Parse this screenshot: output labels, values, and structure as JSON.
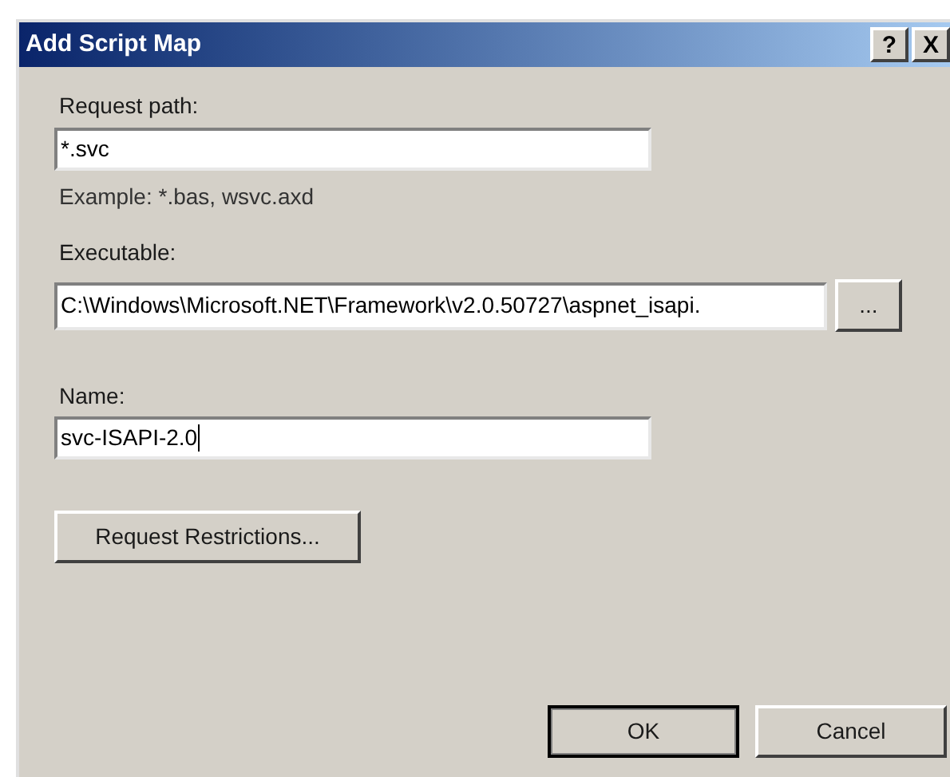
{
  "window": {
    "title": "Add Script Map",
    "title_buttons": [
      "?",
      "X"
    ]
  },
  "fields": [
    {
      "label": "Request path:",
      "value": "*.svc",
      "hint": "Example: *.bas, wsvc.axd",
      "focused": false
    },
    {
      "label": "Executable:",
      "value": "C:\\Windows\\Microsoft.NET\\Framework\\v2.0.50727\\aspnet_isapi.",
      "browse": "...",
      "focused": false
    },
    {
      "label": "Name:",
      "value": "svc-ISAPI-2.0",
      "focused": true
    }
  ],
  "restrictions_button": "Request Restrictions...",
  "buttons": [
    {
      "label": "OK",
      "default": true
    },
    {
      "label": "Cancel",
      "default": false
    }
  ]
}
